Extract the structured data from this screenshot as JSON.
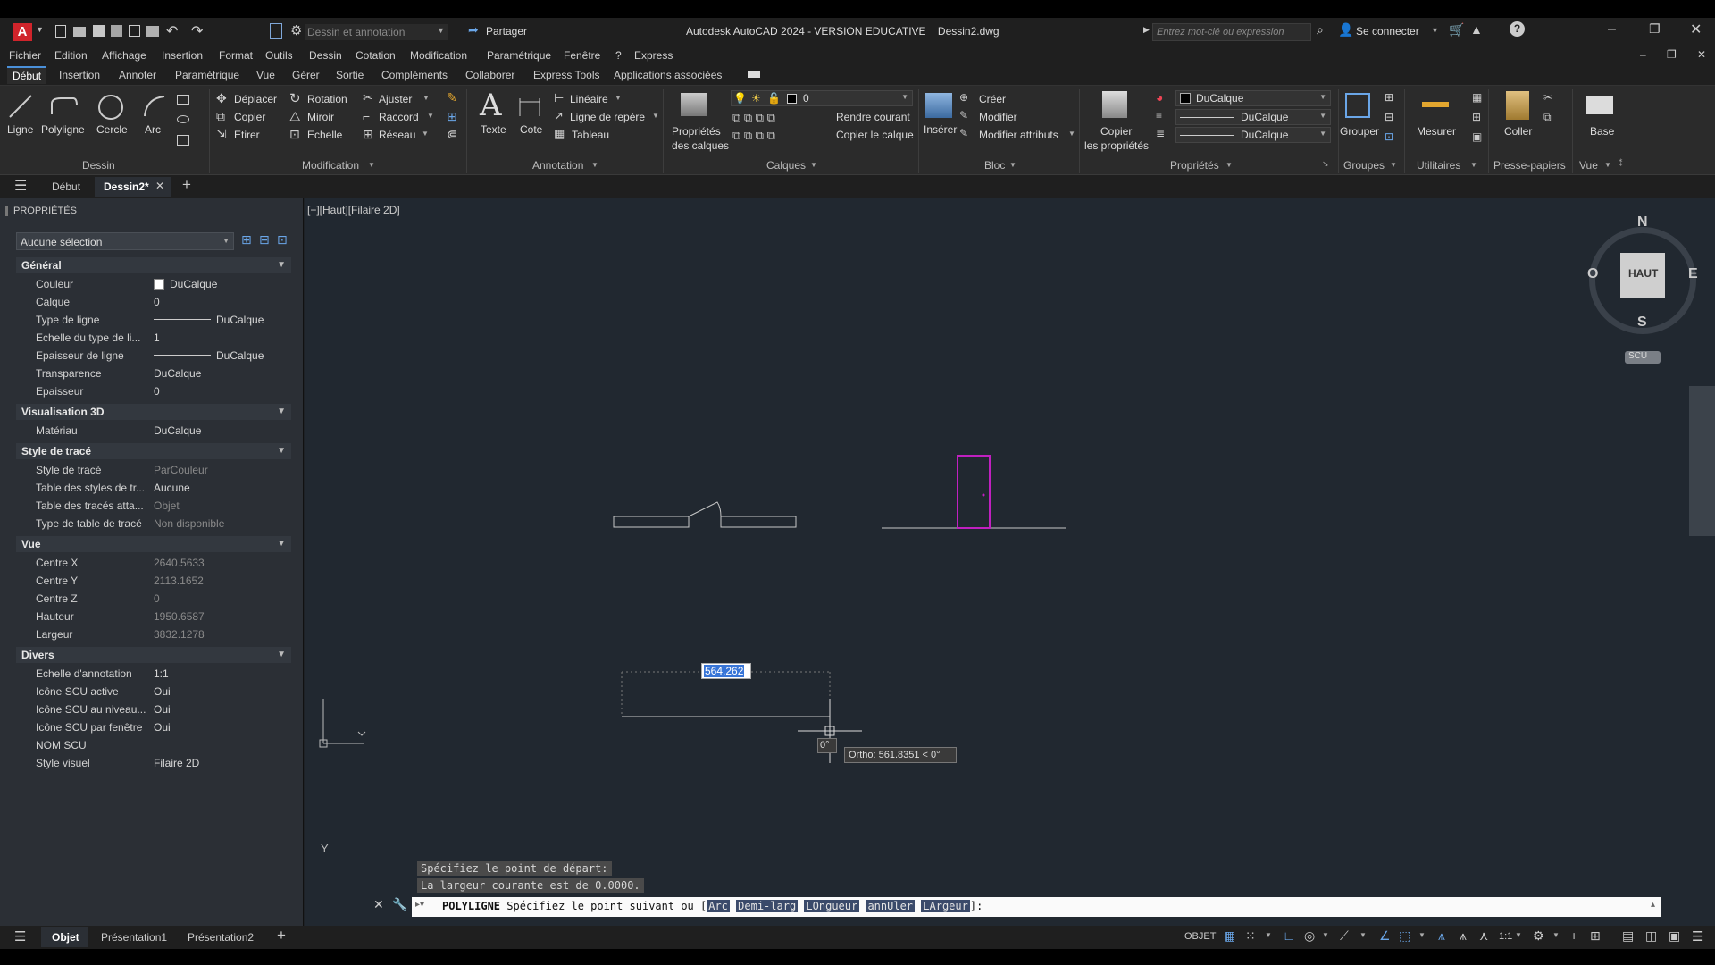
{
  "title": {
    "app": "Autodesk AutoCAD 2024 - VERSION EDUCATIVE",
    "file": "Dessin2.dwg",
    "workspace": "Dessin et annotation",
    "share": "Partager",
    "search_placeholder": "Entrez mot-clé ou expression",
    "signin": "Se connecter"
  },
  "menu": [
    "Fichier",
    "Edition",
    "Affichage",
    "Insertion",
    "Format",
    "Outils",
    "Dessin",
    "Cotation",
    "Modification",
    "Paramétrique",
    "Fenêtre",
    "?",
    "Express"
  ],
  "tabs": [
    "Début",
    "Insertion",
    "Annoter",
    "Paramétrique",
    "Vue",
    "Gérer",
    "Sortie",
    "Compléments",
    "Collaborer",
    "Express Tools",
    "Applications associées"
  ],
  "ribbon": {
    "dessin": {
      "ligne": "Ligne",
      "polyligne": "Polyligne",
      "cercle": "Cercle",
      "arc": "Arc",
      "group": "Dessin"
    },
    "modification": {
      "deplacer": "Déplacer",
      "rotation": "Rotation",
      "ajuster": "Ajuster",
      "copier": "Copier",
      "miroir": "Miroir",
      "raccord": "Raccord",
      "etirer": "Etirer",
      "echelle": "Echelle",
      "reseau": "Réseau",
      "group": "Modification"
    },
    "annotation": {
      "texte": "Texte",
      "cote": "Cote",
      "lineaire": "Linéaire",
      "ligne_repere": "Ligne de repère",
      "tableau": "Tableau",
      "group": "Annotation"
    },
    "calques": {
      "proprietes1": "Propriétés",
      "proprietes2": "des calques",
      "layer_value": "0",
      "rendre_courant": "Rendre courant",
      "copier_calque": "Copier le calque",
      "group": "Calques"
    },
    "bloc": {
      "inserer": "Insérer",
      "creer": "Créer",
      "modifier": "Modifier",
      "modifier_attributs": "Modifier attributs",
      "group": "Bloc"
    },
    "proprietes": {
      "copier1": "Copier",
      "copier2": "les propriétés",
      "color": "DuCalque",
      "linetype": "DuCalque",
      "lineweight": "DuCalque",
      "group": "Propriétés"
    },
    "groupes": {
      "grouper": "Grouper",
      "group": "Groupes"
    },
    "utilitaires": {
      "mesurer": "Mesurer",
      "group": "Utilitaires"
    },
    "presse": {
      "coller": "Coller",
      "group": "Presse-papiers"
    },
    "vue": {
      "base": "Base",
      "group": "Vue"
    }
  },
  "filetabs": {
    "debut": "Début",
    "dessin": "Dessin2*"
  },
  "properties": {
    "title": "PROPRIÉTÉS",
    "selection": "Aucune sélection",
    "sections": {
      "general": "Général",
      "vis3d": "Visualisation 3D",
      "style": "Style de tracé",
      "vue": "Vue",
      "divers": "Divers"
    },
    "general": [
      {
        "k": "Couleur",
        "v": "DuCalque"
      },
      {
        "k": "Calque",
        "v": "0"
      },
      {
        "k": "Type de ligne",
        "v": "DuCalque"
      },
      {
        "k": "Echelle du type de li...",
        "v": "1"
      },
      {
        "k": "Epaisseur de ligne",
        "v": "DuCalque"
      },
      {
        "k": "Transparence",
        "v": "DuCalque"
      },
      {
        "k": "Epaisseur",
        "v": "0"
      }
    ],
    "vis3d": [
      {
        "k": "Matériau",
        "v": "DuCalque"
      }
    ],
    "style": [
      {
        "k": "Style de tracé",
        "v": "ParCouleur"
      },
      {
        "k": "Table des styles de tr...",
        "v": "Aucune"
      },
      {
        "k": "Table des tracés atta...",
        "v": "Objet"
      },
      {
        "k": "Type de table de tracé",
        "v": "Non disponible"
      }
    ],
    "vue": [
      {
        "k": "Centre X",
        "v": "2640.5633"
      },
      {
        "k": "Centre Y",
        "v": "2113.1652"
      },
      {
        "k": "Centre Z",
        "v": "0"
      },
      {
        "k": "Hauteur",
        "v": "1950.6587"
      },
      {
        "k": "Largeur",
        "v": "3832.1278"
      }
    ],
    "divers": [
      {
        "k": "Echelle d'annotation",
        "v": "1:1"
      },
      {
        "k": "Icône SCU active",
        "v": "Oui"
      },
      {
        "k": "Icône SCU au niveau...",
        "v": "Oui"
      },
      {
        "k": "Icône SCU par fenêtre",
        "v": "Oui"
      },
      {
        "k": "NOM SCU",
        "v": ""
      },
      {
        "k": "Style visuel",
        "v": "Filaire 2D"
      }
    ]
  },
  "viewport": {
    "label": "[−][Haut][Filaire 2D]",
    "compass": {
      "n": "N",
      "s": "S",
      "e": "E",
      "o": "O",
      "center": "HAUT",
      "scu": "SCU"
    },
    "dyn_input": "564.262",
    "angle": "0°",
    "ortho": "Ortho: 561.8351 < 0°",
    "axis_y": "Y"
  },
  "command": {
    "hist1": "Spécifiez le point de départ:",
    "hist2": "La largeur courante est de 0.0000.",
    "cmd": "POLYLIGNE",
    "prompt": "Spécifiez le point suivant ou [",
    "opts": [
      "Arc",
      "Demi-larg",
      "LOngueur",
      "annUler",
      "LArgeur"
    ],
    "end": "]:"
  },
  "status": {
    "tabs": [
      "Objet",
      "Présentation1",
      "Présentation2"
    ],
    "objet": "OBJET",
    "scale": "1:1"
  },
  "colors": {
    "accent": "#4a90d9",
    "door": "#c020c0"
  }
}
